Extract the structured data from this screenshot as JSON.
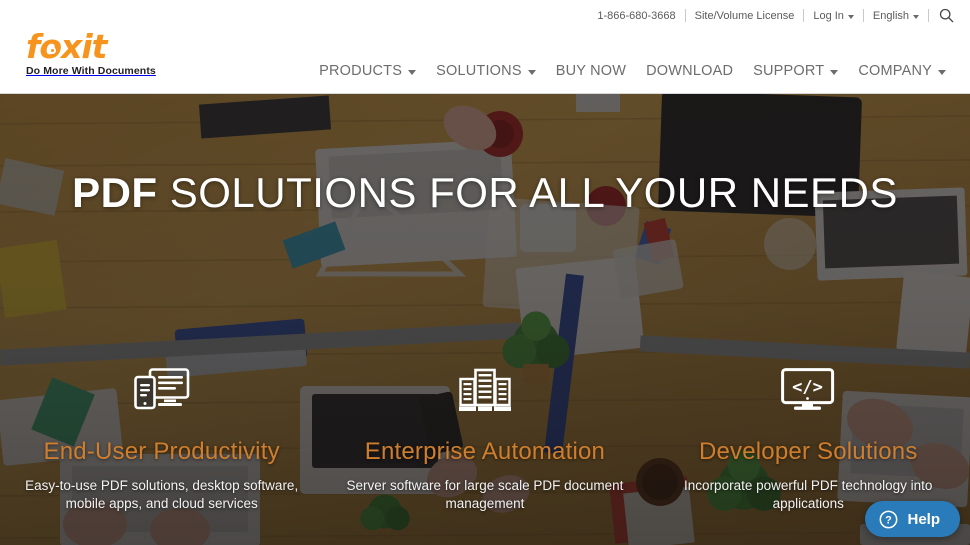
{
  "header": {
    "utility": [
      {
        "label": "1-866-680-3668",
        "type": "phone",
        "caret": false
      },
      {
        "label": "Site/Volume License",
        "type": "link",
        "caret": false
      },
      {
        "label": "Log In",
        "type": "menu",
        "caret": true
      },
      {
        "label": "English",
        "type": "menu",
        "caret": true
      }
    ],
    "search_icon": "search-icon",
    "logo": {
      "wordmark": "foxit",
      "tagline": "Do More With Documents",
      "color": "#f7941e"
    },
    "nav": [
      {
        "label": "PRODUCTS",
        "caret": true
      },
      {
        "label": "SOLUTIONS",
        "caret": true
      },
      {
        "label": "BUY NOW",
        "caret": false
      },
      {
        "label": "DOWNLOAD",
        "caret": false
      },
      {
        "label": "SUPPORT",
        "caret": true
      },
      {
        "label": "COMPANY",
        "caret": true
      }
    ]
  },
  "hero": {
    "title_bold": "PDF",
    "title_rest": " SOLUTIONS FOR ALL YOUR NEEDS",
    "columns": [
      {
        "icon": "devices-monitor-phone-icon",
        "title": "End-User Productivity",
        "desc": "Easy-to-use PDF solutions, desktop software, mobile apps, and cloud services"
      },
      {
        "icon": "server-buildings-icon",
        "title": "Enterprise Automation",
        "desc": "Server software for large scale PDF document management"
      },
      {
        "icon": "code-monitor-icon",
        "title": "Developer Solutions",
        "desc": "Incorporate powerful PDF technology into applications"
      }
    ],
    "heading_color": "#cf7e2e"
  },
  "help_widget": {
    "label": "Help",
    "icon": "question-circle-icon",
    "color": "#2a7bb9"
  }
}
